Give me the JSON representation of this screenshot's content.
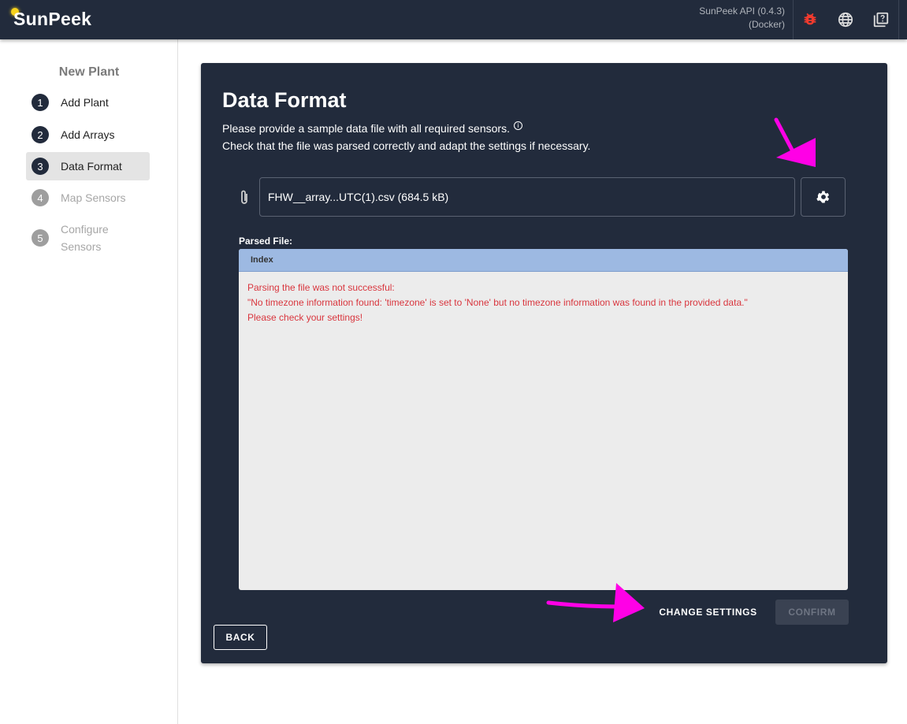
{
  "header": {
    "logo": "SunPeek",
    "api_version": "SunPeek API (0.4.3)",
    "deployment": "(Docker)",
    "icons": [
      "bug-icon",
      "globe-icon",
      "help-docs-icon"
    ],
    "bug_color": "#f03a2e"
  },
  "sidebar": {
    "title": "New Plant",
    "steps": [
      {
        "num": "1",
        "label": "Add Plant",
        "state": "done"
      },
      {
        "num": "2",
        "label": "Add Arrays",
        "state": "done"
      },
      {
        "num": "3",
        "label": "Data Format",
        "state": "active"
      },
      {
        "num": "4",
        "label": "Map Sensors",
        "state": "disabled"
      },
      {
        "num": "5",
        "label": "Configure Sensors",
        "state": "disabled"
      }
    ]
  },
  "main": {
    "title": "Data Format",
    "desc1": "Please provide a sample data file with all required sensors.",
    "desc2": "Check that the file was parsed correctly and adapt the settings if necessary.",
    "file_value": "FHW__array...UTC(1).csv (684.5 kB)",
    "parsed_label": "Parsed File:",
    "table_header": "Index",
    "error_lines": [
      "Parsing the file was not successful:",
      "\"No timezone information found: 'timezone' is set to 'None' but no timezone information was found in the provided data.\"",
      "Please check your settings!"
    ],
    "back": "BACK",
    "change_settings": "CHANGE SETTINGS",
    "confirm": "CONFIRM"
  },
  "annotation_color": "#ff00e6"
}
